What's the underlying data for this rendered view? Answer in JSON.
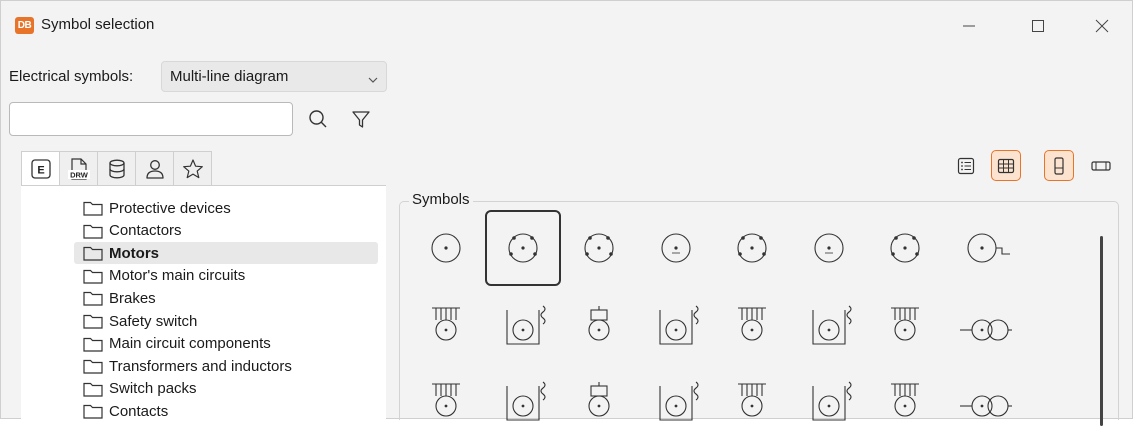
{
  "window": {
    "app_icon_text": "DB",
    "title": "Symbol selection",
    "controls": [
      "minimize",
      "maximize",
      "close"
    ]
  },
  "filter": {
    "label": "Electrical symbols:",
    "selected": "Multi-line diagram"
  },
  "search": {
    "value": "",
    "placeholder": ""
  },
  "tabs": [
    {
      "name": "electrical-tab",
      "icon": "E",
      "active": true
    },
    {
      "name": "drw-tab",
      "icon": "DRW",
      "active": false
    },
    {
      "name": "database-tab",
      "icon": "database-icon",
      "active": false
    },
    {
      "name": "user-tab",
      "icon": "user-icon",
      "active": false
    },
    {
      "name": "favorites-tab",
      "icon": "star-icon",
      "active": false
    }
  ],
  "tree": {
    "items": [
      {
        "label": "Protective devices",
        "selected": false
      },
      {
        "label": "Contactors",
        "selected": false
      },
      {
        "label": "Motors",
        "selected": true
      },
      {
        "label": "Motor's main circuits",
        "selected": false
      },
      {
        "label": "Brakes",
        "selected": false
      },
      {
        "label": "Safety switch",
        "selected": false
      },
      {
        "label": "Main circuit components",
        "selected": false
      },
      {
        "label": "Transformers and inductors",
        "selected": false
      },
      {
        "label": "Switch packs",
        "selected": false
      },
      {
        "label": "Contacts",
        "selected": false
      }
    ]
  },
  "view_buttons": [
    {
      "name": "list-view-button",
      "active": false
    },
    {
      "name": "grid-view-button",
      "active": true
    },
    {
      "name": "portrait-layout-button",
      "active": true
    },
    {
      "name": "landscape-layout-button",
      "active": false
    }
  ],
  "symbols": {
    "label": "Symbols",
    "selected_index": 1,
    "rows": [
      [
        "motor-symbol",
        "motor-3phase-symbol",
        "motor-terminals-symbol",
        "motor-dc-symbol",
        "motor-3phase-alt-symbol",
        "motor-1phase-symbol",
        "motor-terminals-alt-symbol",
        "generator-symbol"
      ],
      [
        "motor-feed-symbol",
        "motor-winding-symbol",
        "motor-compact-symbol",
        "motor-frame-symbol",
        "motor-stack-symbol",
        "motor-coil-symbol",
        "motor-double-feed-symbol",
        "motor-tandem-symbol"
      ],
      [
        "motor-dual-feed-symbol",
        "motor-pair-symbol",
        "motor-box-symbol",
        "motor-coil-alt-symbol",
        "motor-6wire-symbol",
        "motor-dahlander-symbol",
        "motor-twin-symbol",
        "motor-coil-pair-symbol"
      ]
    ]
  },
  "colors": {
    "accent": "#e8742a",
    "accent_fill": "#fbe3cf",
    "background": "#f3f3f3"
  }
}
